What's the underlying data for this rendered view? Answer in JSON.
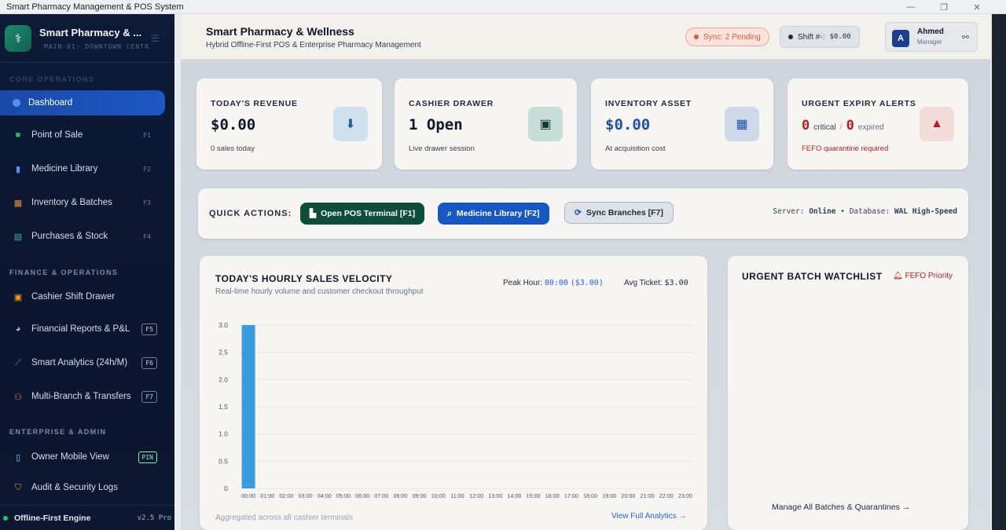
{
  "window": {
    "title": "Smart Pharmacy Management & POS System"
  },
  "sidebar": {
    "brand": "Smart Pharmacy & ...",
    "branch": "MAIN-01: DOWNTOWN CENTR",
    "sections": {
      "core": "CORE OPERATIONS",
      "finance": "FINANCE & OPERATIONS",
      "enterprise": "ENTERPRISE & ADMIN"
    },
    "items": [
      {
        "label": "Dashboard",
        "key": ""
      },
      {
        "label": "Point of Sale",
        "key": "F1"
      },
      {
        "label": "Medicine Library",
        "key": "F2"
      },
      {
        "label": "Inventory & Batches",
        "key": "F3"
      },
      {
        "label": "Purchases & Stock",
        "key": "F4"
      },
      {
        "label": "Cashier Shift Drawer",
        "key": ""
      },
      {
        "label": "Financial Reports & P&L",
        "key": "F5"
      },
      {
        "label": "Smart Analytics (24h/M)",
        "key": "F6"
      },
      {
        "label": "Multi-Branch & Transfers",
        "key": "F7"
      },
      {
        "label": "Owner Mobile View",
        "key": "PIN"
      },
      {
        "label": "Audit & Security Logs",
        "key": ""
      }
    ],
    "footer": {
      "label": "Offline-First Engine",
      "version": "v2.5 Pro"
    }
  },
  "header": {
    "title": "Smart Pharmacy & Wellness",
    "subtitle": "Hybrid Offline-First POS & Enterprise Pharmacy Management",
    "sync": "Sync: 2 Pending",
    "shift_label": "Shift #-:",
    "shift_value": "$0.00",
    "user": {
      "initial": "A",
      "name": "Ahmed",
      "role": "Manager"
    }
  },
  "stats": {
    "revenue": {
      "label": "TODAY'S REVENUE",
      "value": "$0.00",
      "sub": "0 sales today"
    },
    "drawer": {
      "label": "CASHIER DRAWER",
      "value": "1 Open",
      "sub": "Live drawer session"
    },
    "inventory": {
      "label": "INVENTORY ASSET",
      "value": "$0.00",
      "sub": "At acquisition cost"
    },
    "expiry": {
      "label": "URGENT EXPIRY ALERTS",
      "critical_count": "0",
      "critical_label": "critical",
      "sep": "/",
      "expired_count": "0",
      "expired_label": "expired",
      "sub": "FEFO quarantine required"
    }
  },
  "quick_actions": {
    "label": "QUICK ACTIONS:",
    "pos": "Open POS Terminal [F1]",
    "library": "Medicine Library [F2]",
    "sync": "Sync Branches [F7]",
    "server_label": "Server:",
    "server_value": "Online",
    "db_label": "• Database:",
    "db_value": "WAL High-Speed"
  },
  "velocity": {
    "title": "TODAY'S HOURLY SALES VELOCITY",
    "subtitle": "Real-time hourly volume and customer checkout throughput",
    "peak_label": "Peak Hour:",
    "peak_value": "00:00",
    "peak_amount": "($3.00)",
    "avg_label": "Avg Ticket:",
    "avg_value": "$3.00",
    "footer": "Aggregated across all cashier terminals",
    "link": "View Full Analytics →"
  },
  "watchlist": {
    "title": "URGENT BATCH WATCHLIST",
    "priority": "FEFO Priority",
    "link": "Manage All Batches & Quarantines →"
  },
  "colors": {
    "accent": "#1657c4",
    "success": "#0d4d3a",
    "danger": "#b91c1c",
    "bar": "#3a9be0"
  },
  "chart_data": {
    "type": "bar",
    "categories": [
      "00:00",
      "01:00",
      "02:00",
      "03:00",
      "04:00",
      "05:00",
      "06:00",
      "07:00",
      "08:00",
      "09:00",
      "10:00",
      "11:00",
      "12:00",
      "13:00",
      "14:00",
      "15:00",
      "16:00",
      "17:00",
      "18:00",
      "19:00",
      "20:00",
      "21:00",
      "22:00",
      "23:00"
    ],
    "values": [
      3,
      0,
      0,
      0,
      0,
      0,
      0,
      0,
      0,
      0,
      0,
      0,
      0,
      0,
      0,
      0,
      0,
      0,
      0,
      0,
      0,
      0,
      0,
      0
    ],
    "yticks": [
      "0",
      "0.5",
      "1.0",
      "1.5",
      "2.0",
      "2.5",
      "3.0"
    ],
    "ylim": [
      0,
      3
    ],
    "grid": true
  }
}
